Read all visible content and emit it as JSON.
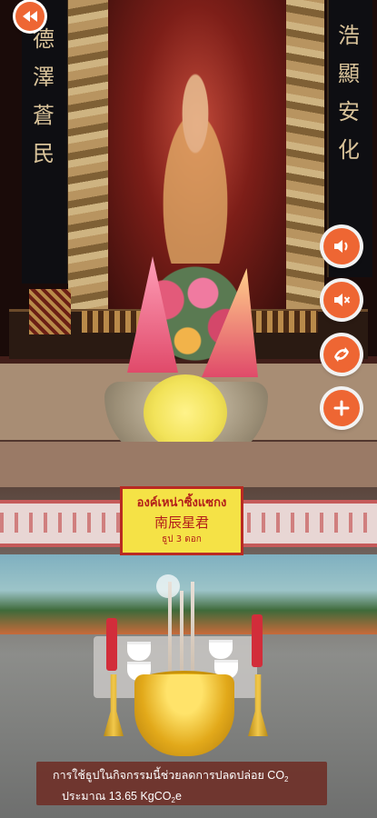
{
  "shrine": {
    "calligraphy_left": [
      "德",
      "澤",
      "蒼",
      "民"
    ],
    "calligraphy_right": [
      "浩",
      "顯",
      "安",
      "化"
    ],
    "plaque": {
      "line1": "องค์เหน่าซิ้งแซกง",
      "line2": "南辰星君",
      "line3": "ธูป 3 ดอก"
    }
  },
  "controls": {
    "back_icon": "rewind-icon",
    "sound_on_icon": "speaker-on-icon",
    "sound_off_icon": "speaker-mute-icon",
    "swap_icon": "swap-arrows-icon",
    "add_icon": "plus-icon",
    "accent_color": "#ee6633"
  },
  "co2_banner": {
    "line1_text": "การใช้ธูปในกิจกรรมนี้ช่วยลดการปลดปล่อย CO",
    "line1_sub": "2",
    "line2_prefix": "ประมาณ  13.65  KgCO",
    "line2_sub": "2",
    "line2_suffix": "e"
  }
}
